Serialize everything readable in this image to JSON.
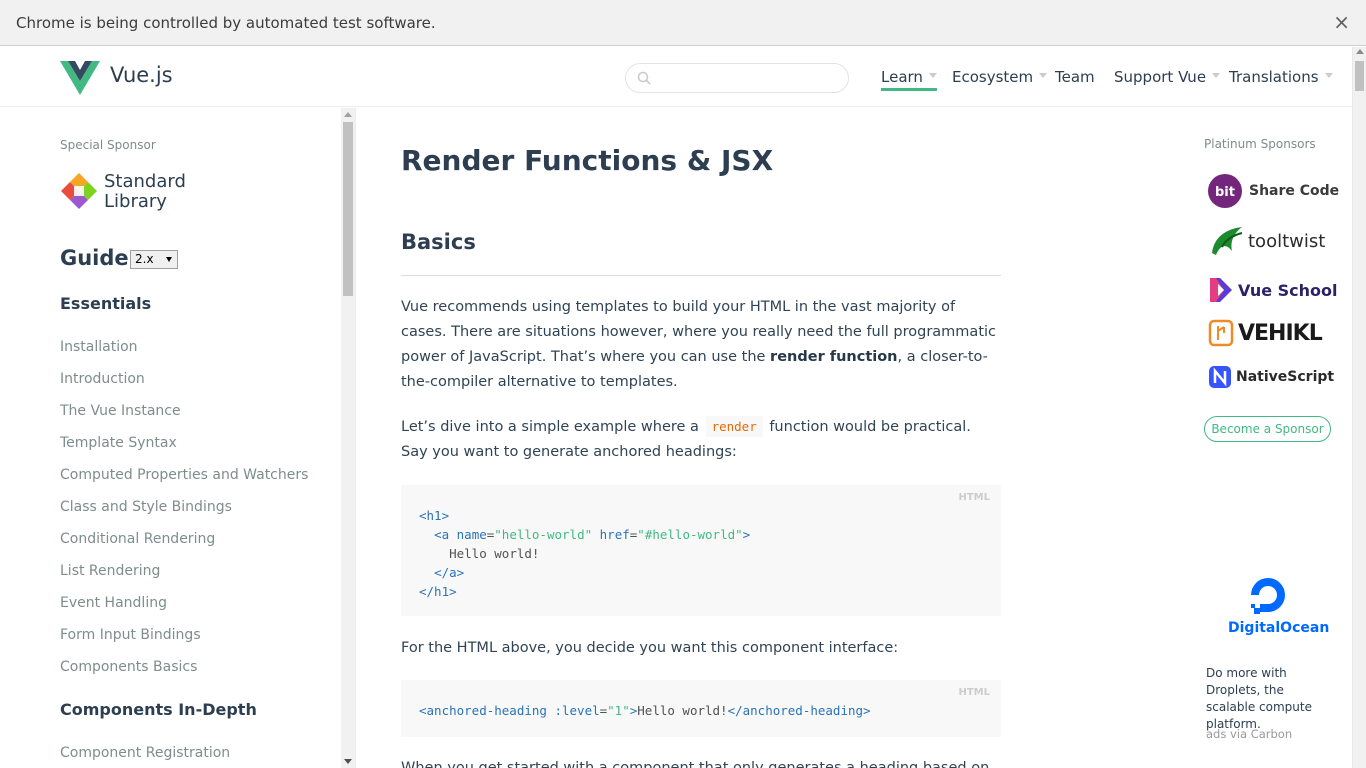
{
  "infobar": {
    "message": "Chrome is being controlled by automated test software.",
    "close": "×"
  },
  "header": {
    "brand": "Vue.js",
    "search": {
      "placeholder": "",
      "value": ""
    },
    "nav": [
      {
        "label": "Learn",
        "dropdown": true,
        "active": true
      },
      {
        "label": "Ecosystem",
        "dropdown": true
      },
      {
        "label": "Team",
        "dropdown": false
      },
      {
        "label": "Support Vue",
        "dropdown": true
      },
      {
        "label": "Translations",
        "dropdown": true
      }
    ],
    "accent": "#42b983"
  },
  "sidebar": {
    "special_sponsor": "Special Sponsor",
    "stdlib_line1": "Standard",
    "stdlib_line2": "Library",
    "guide": "Guide",
    "version": "2.x",
    "sections": [
      {
        "title": "Essentials",
        "links": [
          "Installation",
          "Introduction",
          "The Vue Instance",
          "Template Syntax",
          "Computed Properties and Watchers",
          "Class and Style Bindings",
          "Conditional Rendering",
          "List Rendering",
          "Event Handling",
          "Form Input Bindings",
          "Components Basics"
        ]
      },
      {
        "title": "Components In-Depth",
        "links": [
          "Component Registration"
        ]
      }
    ]
  },
  "content": {
    "title": "Render Functions & JSX",
    "h2_basics": "Basics",
    "p1_a": "Vue recommends using templates to build your HTML in the vast majority of cases. There are situations however, where you really need the full programmatic power of JavaScript. That’s where you can use the ",
    "p1_strong": "render function",
    "p1_b": ", a closer-to-the-compiler alternative to templates.",
    "p2_a": "Let’s dive into a simple example where a ",
    "p2_code": "render",
    "p2_b": " function would be practical. Say you want to generate anchored headings:",
    "code1_lang": "HTML",
    "code1": {
      "l1": "<h1>",
      "l2_open": "<a ",
      "l2_attr1": "name",
      "l2_eq1": "=",
      "l2_val1": "\"hello-world\"",
      "l2_attr2": " href",
      "l2_eq2": "=",
      "l2_val2": "\"#hello-world\"",
      "l2_close": ">",
      "l3": "Hello world!",
      "l4": "</a>",
      "l5": "</h1>"
    },
    "p3": "For the HTML above, you decide you want this component interface:",
    "code2_lang": "HTML",
    "code2": {
      "open": "<anchored-heading ",
      "attr": ":level",
      "eq": "=",
      "val": "\"1\"",
      "gt": ">",
      "text": "Hello world!",
      "close": "</anchored-heading>"
    },
    "p4_partial": "When you get started with a component that only generates a heading based on the"
  },
  "right": {
    "platinum": "Platinum Sponsors",
    "sponsors": [
      {
        "name": "bit",
        "label": "Share Code",
        "icon": "bit-logo-icon"
      },
      {
        "name": "tooltwist",
        "label": "tooltwist",
        "icon": "tooltwist-logo-icon"
      },
      {
        "name": "Vue School",
        "label": "Vue School",
        "icon": "vueschool-logo-icon"
      },
      {
        "name": "VEHIKL",
        "label": "VEHIKL",
        "icon": "vehikl-logo-icon"
      },
      {
        "name": "NativeScript",
        "label": "NativeScript",
        "icon": "nativescript-logo-icon"
      }
    ],
    "become": "Become a Sponsor",
    "digitalocean": "DigitalOcean",
    "carbon_text": "Do more with Droplets, the scalable compute platform.",
    "via": "ads via Carbon"
  }
}
